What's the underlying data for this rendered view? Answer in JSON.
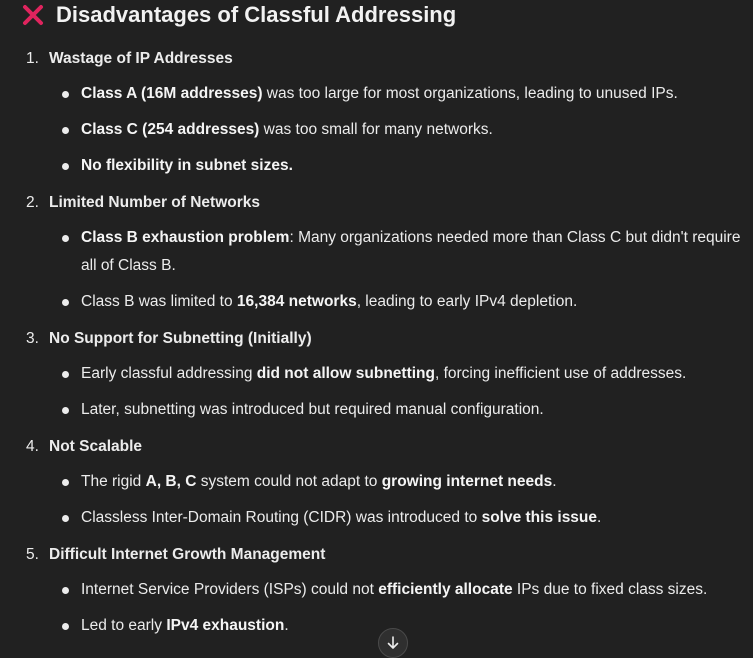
{
  "heading": {
    "icon": "x-mark-icon",
    "icon_color": "#e0245e",
    "title": "Disadvantages of Classful Addressing"
  },
  "sections": [
    {
      "number": "1.",
      "title": "Wastage of IP Addresses",
      "items": [
        [
          {
            "t": "Class A (16M addresses)",
            "b": true
          },
          {
            "t": " was too large for most organizations, leading to unused IPs.",
            "b": false
          }
        ],
        [
          {
            "t": "Class C (254 addresses)",
            "b": true
          },
          {
            "t": " was too small for many networks.",
            "b": false
          }
        ],
        [
          {
            "t": "No flexibility in subnet sizes.",
            "b": true
          }
        ]
      ]
    },
    {
      "number": "2.",
      "title": "Limited Number of Networks",
      "items": [
        [
          {
            "t": "Class B exhaustion problem",
            "b": true
          },
          {
            "t": ": Many organizations needed more than Class C but didn't require all of Class B.",
            "b": false
          }
        ],
        [
          {
            "t": "Class B was limited to ",
            "b": false
          },
          {
            "t": "16,384 networks",
            "b": true
          },
          {
            "t": ", leading to early IPv4 depletion.",
            "b": false
          }
        ]
      ]
    },
    {
      "number": "3.",
      "title": "No Support for Subnetting (Initially)",
      "items": [
        [
          {
            "t": "Early classful addressing ",
            "b": false
          },
          {
            "t": "did not allow subnetting",
            "b": true
          },
          {
            "t": ", forcing inefficient use of addresses.",
            "b": false
          }
        ],
        [
          {
            "t": "Later, subnetting was introduced but required manual configuration.",
            "b": false
          }
        ]
      ]
    },
    {
      "number": "4.",
      "title": "Not Scalable",
      "items": [
        [
          {
            "t": "The rigid ",
            "b": false
          },
          {
            "t": "A, B, C",
            "b": true
          },
          {
            "t": " system could not adapt to ",
            "b": false
          },
          {
            "t": "growing internet needs",
            "b": true
          },
          {
            "t": ".",
            "b": false
          }
        ],
        [
          {
            "t": "Classless Inter-Domain Routing (CIDR) was introduced to ",
            "b": false
          },
          {
            "t": "solve this issue",
            "b": true
          },
          {
            "t": ".",
            "b": false
          }
        ]
      ]
    },
    {
      "number": "5.",
      "title": "Difficult Internet Growth Management",
      "items": [
        [
          {
            "t": "Internet Service Providers (ISPs) could not ",
            "b": false
          },
          {
            "t": "efficiently allocate",
            "b": true
          },
          {
            "t": " IPs due to fixed class sizes.",
            "b": false
          }
        ],
        [
          {
            "t": "Led to early ",
            "b": false
          },
          {
            "t": "IPv4 exhaustion",
            "b": true
          },
          {
            "t": ".",
            "b": false
          }
        ]
      ]
    }
  ],
  "scroll_button": {
    "icon": "arrow-down-icon"
  }
}
